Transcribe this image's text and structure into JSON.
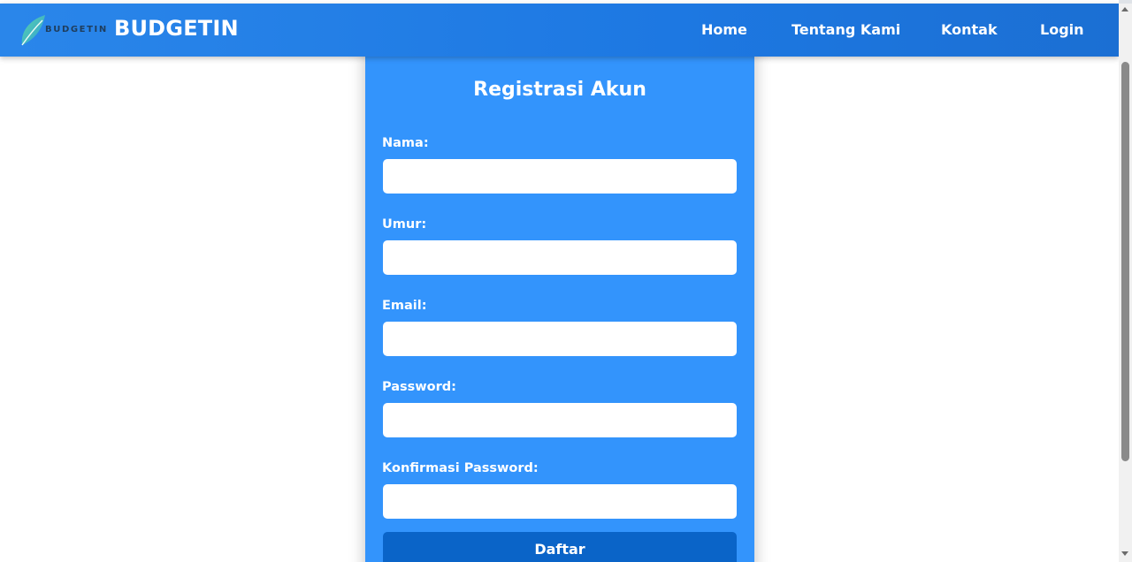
{
  "navbar": {
    "logo_text": "BUDGETIN",
    "brand": "BUDGETIN",
    "links": [
      "Home",
      "Tentang Kami",
      "Kontak",
      "Login"
    ]
  },
  "form": {
    "title": "Registrasi Akun",
    "fields": [
      {
        "label": "Nama:",
        "value": ""
      },
      {
        "label": "Umur:",
        "value": ""
      },
      {
        "label": "Email:",
        "value": ""
      },
      {
        "label": "Password:",
        "value": ""
      },
      {
        "label": "Konfirmasi Password:",
        "value": ""
      }
    ],
    "submit_label": "Daftar"
  },
  "colors": {
    "navbar": "#1d78e2",
    "card": "#3394fc",
    "button": "#0a64c8",
    "text": "#ffffff"
  }
}
